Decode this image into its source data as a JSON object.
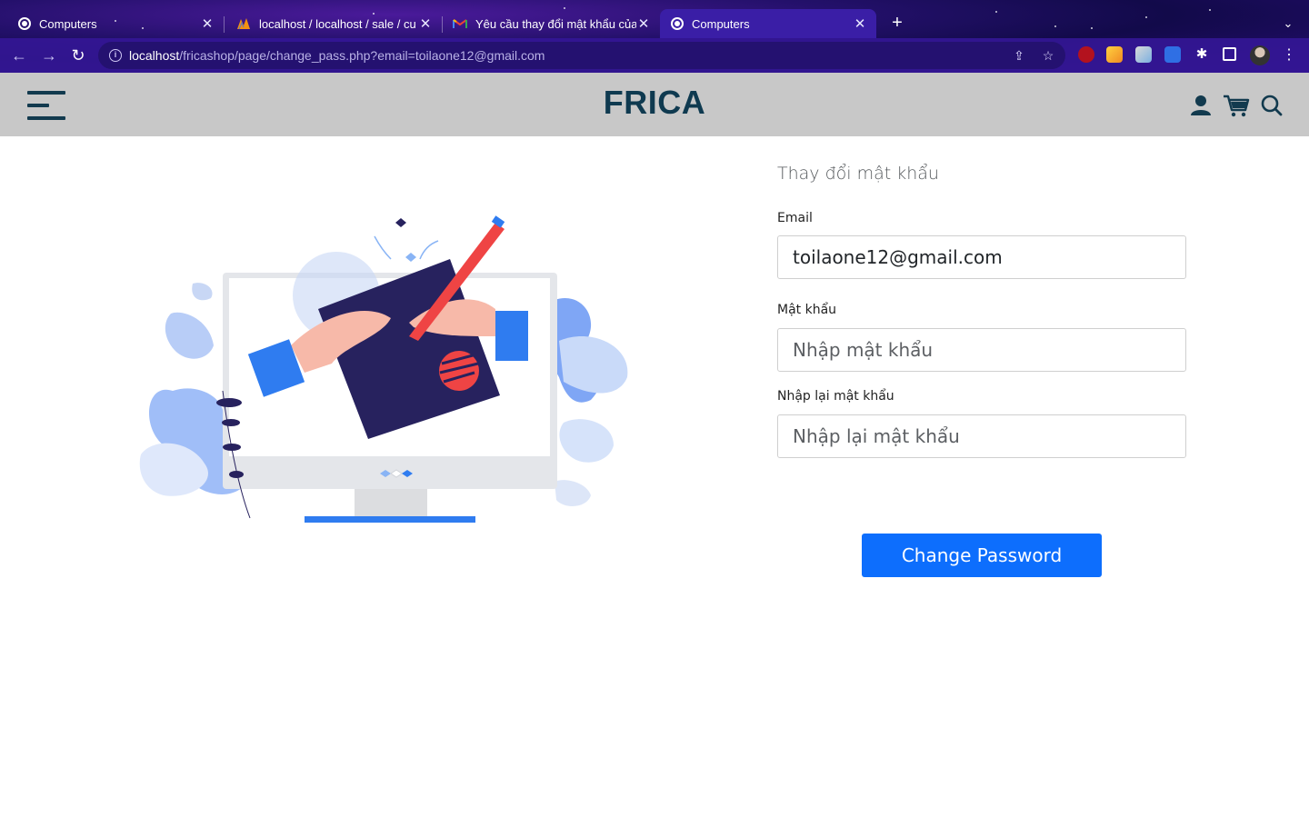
{
  "browser": {
    "tabs": [
      {
        "title": "Computers",
        "favicon": "globe-icon",
        "active": false
      },
      {
        "title": "localhost / localhost / sale / cu",
        "favicon": "phpmyadmin-icon",
        "active": false
      },
      {
        "title": "Yêu cầu thay đổi mật khẩu của",
        "favicon": "gmail-icon",
        "active": false
      },
      {
        "title": "Computers",
        "favicon": "globe-icon",
        "active": true
      }
    ],
    "url_host": "localhost",
    "url_path": "/fricashop/page/change_pass.php?email=toilaone12@gmail.com"
  },
  "header": {
    "logo": "FRICA"
  },
  "form": {
    "title": "Thay đổi mật khẩu",
    "email_label": "Email",
    "email_value": "toilaone12@gmail.com",
    "password_label": "Mật khẩu",
    "password_placeholder": "Nhập mật khẩu",
    "confirm_label": "Nhập lại mật khẩu",
    "confirm_placeholder": "Nhập lại mật khẩu",
    "submit_label": "Change Password"
  },
  "colors": {
    "brand": "#0f3a50",
    "primary_button": "#0d6efd",
    "header_bg": "#c8c8c8"
  }
}
